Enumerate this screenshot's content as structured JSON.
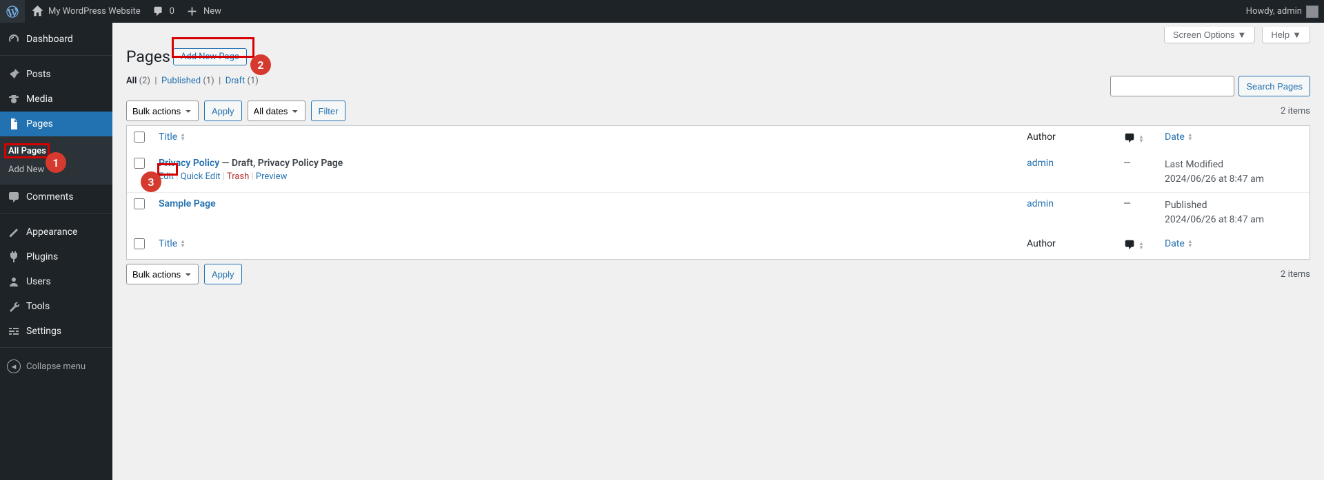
{
  "adminbar": {
    "site_name": "My WordPress Website",
    "comments_count": "0",
    "new_label": "New",
    "howdy_prefix": "Howdy, ",
    "user": "admin"
  },
  "sidebar": {
    "items": [
      {
        "label": "Dashboard"
      },
      {
        "label": "Posts"
      },
      {
        "label": "Media"
      },
      {
        "label": "Pages"
      },
      {
        "label": "Comments"
      },
      {
        "label": "Appearance"
      },
      {
        "label": "Plugins"
      },
      {
        "label": "Users"
      },
      {
        "label": "Tools"
      },
      {
        "label": "Settings"
      }
    ],
    "submenu": {
      "all_pages": "All Pages",
      "add_new": "Add New"
    },
    "collapse": "Collapse menu"
  },
  "screen_meta": {
    "screen_options": "Screen Options",
    "help": "Help"
  },
  "page": {
    "heading": "Pages",
    "add_new": "Add New Page"
  },
  "filters": {
    "all": "All",
    "all_count": "(2)",
    "published": "Published",
    "published_count": "(1)",
    "draft": "Draft",
    "draft_count": "(1)"
  },
  "bulk": {
    "label": "Bulk actions",
    "apply": "Apply",
    "dates": "All dates",
    "filter": "Filter"
  },
  "search": {
    "button": "Search Pages"
  },
  "count_label": "2 items",
  "columns": {
    "title": "Title",
    "author": "Author",
    "date": "Date"
  },
  "rows": [
    {
      "title": "Privacy Policy",
      "state": " — Draft, Privacy Policy Page",
      "author": "admin",
      "comments": "—",
      "date_status": "Last Modified",
      "date_value": "2024/06/26 at 8:47 am",
      "actions": {
        "edit": "Edit",
        "quick": "Quick Edit",
        "trash": "Trash",
        "preview": "Preview"
      }
    },
    {
      "title": "Sample Page",
      "state": "",
      "author": "admin",
      "comments": "—",
      "date_status": "Published",
      "date_value": "2024/06/26 at 8:47 am"
    }
  ],
  "annotations": {
    "b1": "1",
    "b2": "2",
    "b3": "3"
  }
}
